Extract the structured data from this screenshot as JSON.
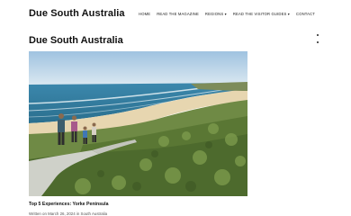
{
  "site": {
    "title": "Due South Australia"
  },
  "nav": {
    "items": [
      {
        "label": "HOME"
      },
      {
        "label": "READ THE MAGAZINE"
      },
      {
        "label": "REGIONS ▾"
      },
      {
        "label": "READ THE VISITOR GUIDES ▾"
      },
      {
        "label": "CONTACT"
      }
    ]
  },
  "page": {
    "heading": "Due South Australia"
  },
  "post": {
    "title": "Top 5 Experiences: Yorke Peninsula",
    "meta_prefix": "Written on March 26, 2024 in ",
    "category": "South Australia",
    "image_alt": "Family walking on a coastal path overlooking a beach"
  },
  "colors": {
    "text": "#111111",
    "meta": "#555555",
    "sky": "#bcd6ea",
    "sea": "#2f7fa6",
    "sand": "#e9d9b8",
    "scrub": "#5b7a3a"
  }
}
